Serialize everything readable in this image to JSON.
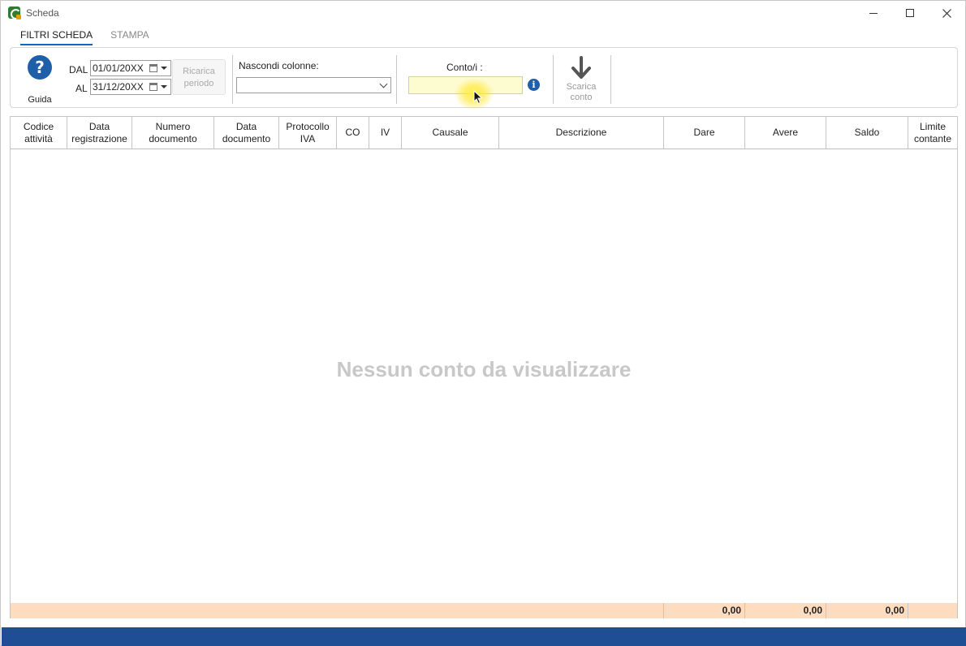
{
  "window": {
    "title": "Scheda",
    "controls": {
      "minimize": "minimize-icon",
      "maximize": "maximize-icon",
      "close": "close-icon"
    }
  },
  "tabs": [
    {
      "label": "FILTRI SCHEDA",
      "active": true
    },
    {
      "label": "STAMPA",
      "active": false
    }
  ],
  "filters": {
    "guide_label": "Guida",
    "date_from_label": "DAL",
    "date_from_value": "01/01/20XX",
    "date_to_label": "AL",
    "date_to_value": "31/12/20XX",
    "reload_label_line1": "Ricarica",
    "reload_label_line2": "periodo",
    "hide_columns_label": "Nascondi colonne:",
    "hide_columns_value": "",
    "account_label": "Conto/i :",
    "account_value": "",
    "download_label_line1": "Scarica",
    "download_label_line2": "conto"
  },
  "grid": {
    "columns": [
      {
        "line1": "Codice",
        "line2": "attività"
      },
      {
        "line1": "Data",
        "line2": "registrazione"
      },
      {
        "line1": "Numero",
        "line2": "documento"
      },
      {
        "line1": "Data",
        "line2": "documento"
      },
      {
        "line1": "Protocollo",
        "line2": "IVA"
      },
      {
        "line1": "CO",
        "line2": ""
      },
      {
        "line1": "IV",
        "line2": ""
      },
      {
        "line1": "Causale",
        "line2": ""
      },
      {
        "line1": "Descrizione",
        "line2": ""
      },
      {
        "line1": "Dare",
        "line2": ""
      },
      {
        "line1": "Avere",
        "line2": ""
      },
      {
        "line1": "Saldo",
        "line2": ""
      },
      {
        "line1": "Limite",
        "line2": "contante"
      }
    ],
    "empty_message": "Nessun conto da visualizzare",
    "totals": {
      "dare": "0,00",
      "avere": "0,00",
      "saldo": "0,00"
    }
  },
  "colors": {
    "accent": "#1f5ea8",
    "statusbar": "#1f4e94",
    "totals_bg": "#fddcbf",
    "account_input_bg": "#fdfbd0"
  }
}
